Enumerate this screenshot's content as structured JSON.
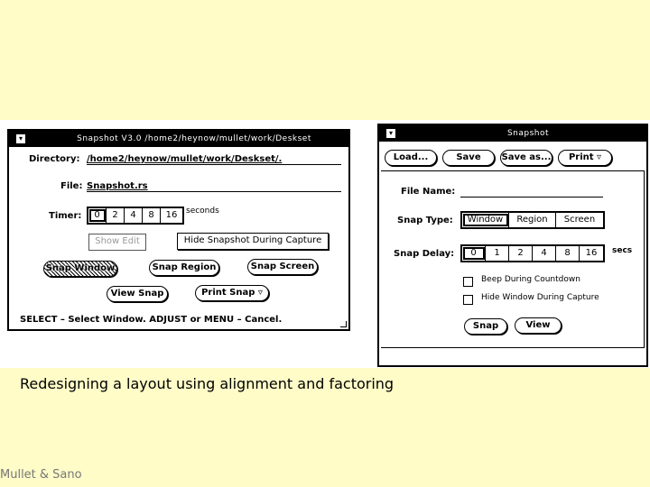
{
  "left_window": {
    "title": "Snapshot V3.0   /home2/heynow/mullet/work/Deskset",
    "menu_glyph": "▾",
    "directory_label": "Directory:",
    "directory_value": "/home2/heynow/mullet/work/Deskset/.",
    "file_label": "File:",
    "file_value": "Snapshot.rs",
    "timer_label": "Timer:",
    "timer_options": [
      "0",
      "2",
      "4",
      "8",
      "16"
    ],
    "timer_selected": "0",
    "timer_unit": "seconds",
    "show_edit_label": "Show Edit",
    "hide_snapshot_label": "Hide Snapshot During Capture",
    "snap_window_label": "Snap Window",
    "snap_region_label": "Snap Region",
    "snap_screen_label": "Snap Screen",
    "view_snap_label": "View Snap",
    "print_snap_label": "Print Snap ▿",
    "footer": "SELECT – Select Window.  ADJUST or MENU – Cancel."
  },
  "right_window": {
    "title": "Snapshot",
    "menu_glyph": "▾",
    "toolbar": {
      "load_label": "Load...",
      "save_label": "Save",
      "save_as_label": "Save as...",
      "print_label": "Print ▿"
    },
    "file_name_label": "File Name:",
    "file_name_value": "",
    "snap_type_label": "Snap Type:",
    "snap_type_options": [
      "Window",
      "Region",
      "Screen"
    ],
    "snap_type_selected": "Window",
    "snap_delay_label": "Snap Delay:",
    "snap_delay_options": [
      "0",
      "1",
      "2",
      "4",
      "8",
      "16"
    ],
    "snap_delay_selected": "0",
    "snap_delay_unit": "secs",
    "beep_label": "Beep During Countdown",
    "beep_checked": false,
    "hide_window_label": "Hide Window During Capture",
    "hide_window_checked": false,
    "snap_label": "Snap",
    "view_label": "View"
  },
  "caption": "Redesigning a layout using alignment and factoring",
  "credit": "Mullet & Sano"
}
